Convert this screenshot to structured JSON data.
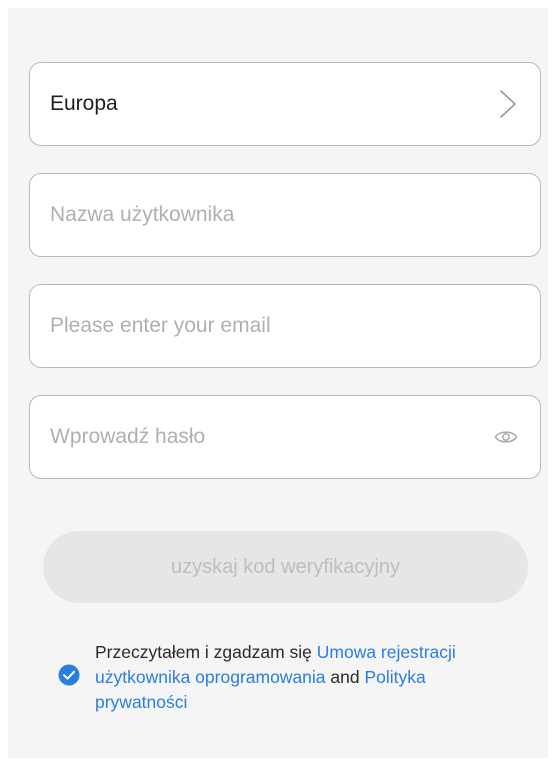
{
  "region": {
    "value": "Europa",
    "icon": "chevron-right-icon"
  },
  "username": {
    "placeholder": "Nazwa użytkownika"
  },
  "email": {
    "placeholder": "Please enter your email"
  },
  "password": {
    "placeholder": "Wprowadź hasło",
    "icon": "eye-icon"
  },
  "verify_button": {
    "label": "uzyskaj kod weryfikacyjny"
  },
  "agreement": {
    "checked": true,
    "prefix": "Przeczytałem i zgadzam się ",
    "link1": "Umowa rejestracji użytkownika oprogramowania",
    "middle": " and ",
    "link2": "Polityka prywatności"
  },
  "colors": {
    "background": "#f5f5f5",
    "accent": "#2a7de1",
    "border": "#b9b9b9",
    "button_disabled_bg": "#e6e6e6",
    "button_disabled_text": "#bdbdbd",
    "placeholder": "#b0b0b0"
  }
}
